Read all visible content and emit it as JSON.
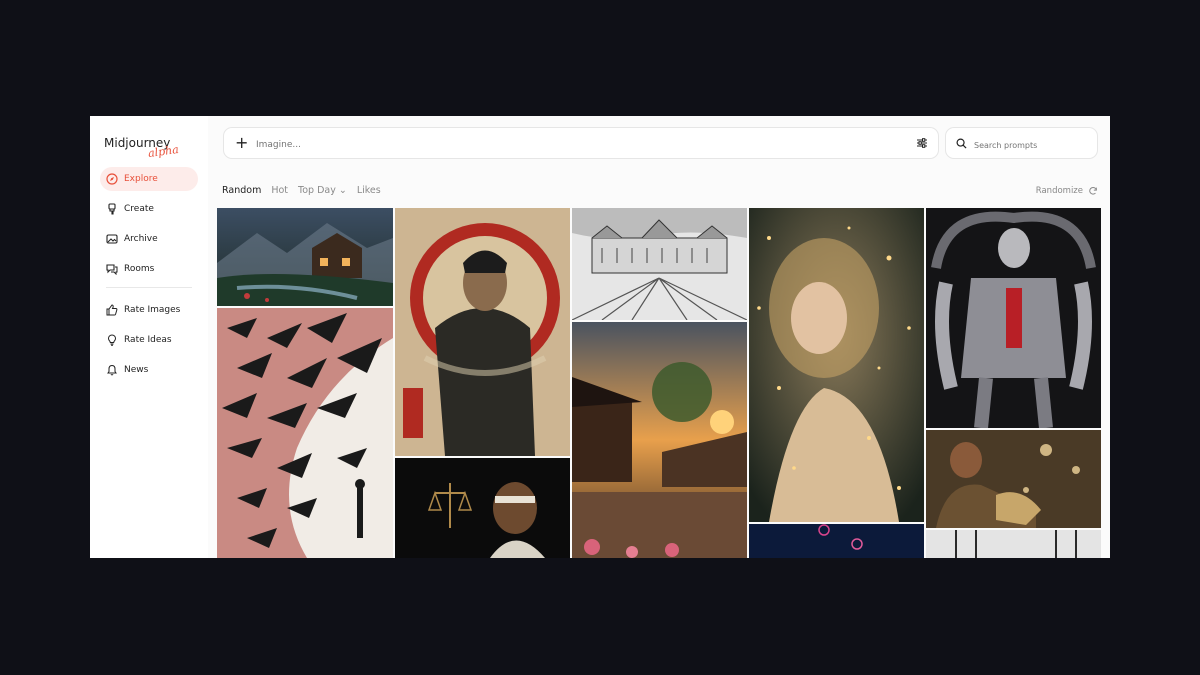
{
  "app": {
    "logo": "Midjourney",
    "logo_sub": "alpha"
  },
  "sidebar": {
    "items": [
      {
        "label": "Explore",
        "icon": "compass-icon",
        "active": true
      },
      {
        "label": "Create",
        "icon": "brush-icon"
      },
      {
        "label": "Archive",
        "icon": "image-icon"
      },
      {
        "label": "Rooms",
        "icon": "chat-icon"
      }
    ],
    "items2": [
      {
        "label": "Rate Images",
        "icon": "thumbs-up-icon"
      },
      {
        "label": "Rate Ideas",
        "icon": "lightbulb-icon"
      },
      {
        "label": "News",
        "icon": "bell-icon"
      }
    ]
  },
  "prompt": {
    "placeholder": "Imagine..."
  },
  "search": {
    "placeholder": "Search prompts"
  },
  "tabs": [
    {
      "label": "Random",
      "active": true
    },
    {
      "label": "Hot"
    },
    {
      "label": "Top Day ⌄"
    },
    {
      "label": "Likes"
    }
  ],
  "randomize_label": "Randomize",
  "colors": {
    "accent": "#e8503a",
    "active_bg": "#fdecea"
  }
}
